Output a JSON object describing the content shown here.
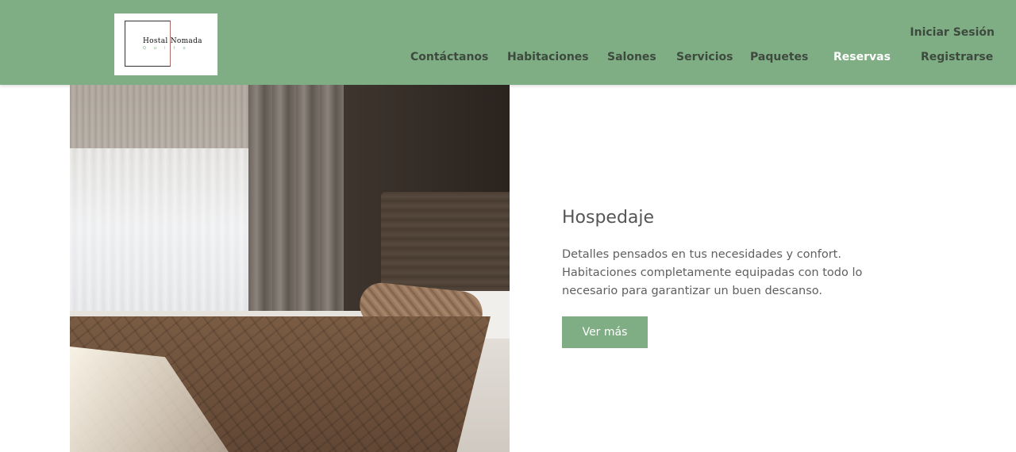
{
  "brand": {
    "name": "Hostal Nomada",
    "subtitle": "Quito",
    "accent_color": "#7fae84"
  },
  "header": {
    "signin_label": "Iniciar Sesión",
    "nav": [
      {
        "label": "Contáctanos"
      },
      {
        "label": "Habitaciones"
      },
      {
        "label": "Salones"
      },
      {
        "label": "Servicios"
      },
      {
        "label": "Paquetes"
      },
      {
        "label": "Reservas",
        "active": true
      },
      {
        "label": "Registrarse"
      }
    ]
  },
  "main": {
    "title": "Hospedaje",
    "description_lines": [
      "Detalles pensados en tus necesidades y confort.",
      "Habitaciones completamente equipadas con todo lo",
      "necesario para garantizar un buen descanso."
    ],
    "cta_label": "Ver más"
  }
}
